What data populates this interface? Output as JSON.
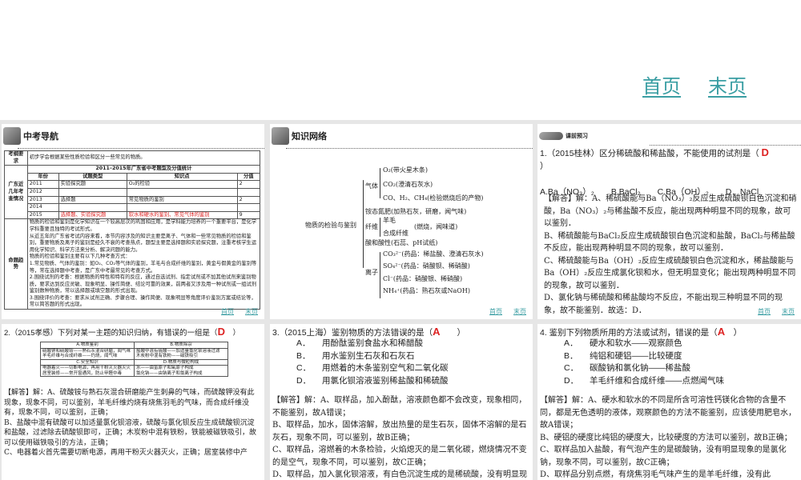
{
  "nav": {
    "home": "首页",
    "end": "末页"
  },
  "panel1": {
    "title": "中考导航",
    "req_label": "考纲要求",
    "req_text": "初步学会根据某些性质检验和区分一些常见的物质。",
    "stats_title": "2011–2015年广东省中考题型及分值统计",
    "recent_label": "广东近几年考查情况",
    "cols": [
      "年份",
      "试题类型",
      "知识点",
      "分值"
    ],
    "rows": [
      [
        "2011",
        "实验探究题",
        "O₂的检验",
        "2"
      ],
      [
        "2012",
        "",
        "",
        ""
      ],
      [
        "2013",
        "选择题",
        "常见物质的鉴别",
        "2"
      ],
      [
        "2014",
        "",
        "",
        ""
      ],
      [
        "2015",
        "选择题、实验探究题",
        "软水和硬水的鉴别、常见气体的鉴别",
        "9"
      ]
    ],
    "trend_label": "命题趋势",
    "trend_text": [
      "物质的检验和鉴别是化学知识在一个较高层次的巩固和应用，是学科能力培养的一个重要平台，是化学学科重要且独特的考试形式。",
      "从近五年的广东省考试内容来看，本节内容涉及的知识主要是离子、气体和一些常见物质的检验和鉴别，重要物质及离子的鉴别是经久不衰的考查热点，题型主要是选择题和实验探究题，注重考核学生运用化学知识、科学方法来分析、解决问题的能力。",
      "物质的检验和鉴别主要有以下几种考查方式：",
      "1.常见物质、气体的鉴别：如O₂、CO₂等气体的鉴别，羊毛与合成纤维的鉴别，黄金与假黄金的鉴别等等，常在选择题中考查，是广东中考最常见的考查方式。",
      "2.围绕试剂的考查：根据物质的特性和特有的反应，通过自选试剂、指定试剂或不加其他试剂来鉴别物质，要求达到反应灵敏、现象明显、操作简便、结论可靠的效果，前两者又涉及用一种试剂或一组试剂鉴别数种物质，常以选择题或填空题的形式出现。",
      "3.围绕评价的考查：要求从试剂正确、步骤合理、操作简便、现象明显等角度评价鉴别方案或结论等，常以简答题的形式出现。"
    ]
  },
  "panel2": {
    "title": "知识网络",
    "root": "物质的检验与鉴别",
    "gas": "气体",
    "gas_items": [
      "O₂(带火星木条)",
      "CO₂(澄清石灰水)",
      "CO、H₂、CH₄(检验燃烧后的产物)"
    ],
    "ammonium": "铵态氮肥(加熟石灰，研磨，闻气味)",
    "fiber": "纤维",
    "fiber_items": [
      "羊毛",
      "合成纤维"
    ],
    "fiber_method": "(燃烧，闻味道)",
    "acid": "酸和酸性(石蕊、pH试纸)",
    "ion": "离子",
    "ion_items": [
      "CO₃²⁻(药品：稀盐酸、澄清石灰水)",
      "SO₄²⁻(药品：硝酸钡、稀硝酸)",
      "Cl⁻(药品：硝酸银、稀硝酸)",
      "NH₄⁺(药品：熟石灰或NaOH)"
    ]
  },
  "panel3": {
    "title": "课前预习",
    "question": "1.（2015桂林）区分稀硫酸和稀盐酸，不能使用的试剂是（",
    "answer": "D",
    "close": "）",
    "options": "A.Ba（NO₃）₂　　B.BaCl₂　　C.Ba（OH）₂　　D．NaCl",
    "solution": [
      "【解答】解：A、稀硫酸能与Ba（NO₃）₂反应生成硫酸钡白色沉淀和硝酸，Ba（NO₃）₂与稀盐酸不反应，能出现两种明显不同的现象，故可以鉴别．",
      "B、稀硫酸能与BaCl₂反应生成硫酸钡白色沉淀和盐酸，BaCl₂与稀盐酸不反应，能出现两种明显不同的现象，故可以鉴别．",
      "C、稀硫酸能与Ba（OH）₂反应生成硫酸钡白色沉淀和水，稀盐酸能与Ba（OH）₂反应生成氯化钡和水，但无明显变化；能出现两种明显不同的现象，故可以鉴别．",
      "D、氯化钠与稀硫酸和稀盐酸均不反应，不能出现三种明显不同的现象，故不能鉴别．故选：D．"
    ]
  },
  "panel4": {
    "question": "2.（2015孝感）下列对某一主题的知识归纳，有错误的一组是（",
    "answer": "D",
    "close": "）",
    "table": [
      {
        "head": "A.物质鉴别",
        "body": [
          "硫酸钾和硫酸铵——熟石灰混合研磨，闻气味",
          "羊毛纤维与合成纤维——灼烧，闻气味"
        ]
      },
      {
        "head": "B.物质除杂",
        "body": [
          "盐酸中混有硫酸——加适量氯化钡溶液过滤",
          "木炭粉中混有铁粉——磁铁吸引"
        ]
      },
      {
        "head": "C.安全知识",
        "body": [
          "电器着火——切断电源，再用干粉灭火器灭火",
          "居室装修——常开窗通风，防止甲醛中毒"
        ]
      },
      {
        "head": "D.物质与微粒构成",
        "body": [
          "水——由氢原子和氧原子构成",
          "氯化钠——由钠离子和氯离子构成"
        ]
      }
    ],
    "solution": [
      "【解答】解：A、硫酸铵与熟石灰混合研磨能产生刺鼻的气味，而硫酸钾没有此现象，现象不同，可以鉴别，羊毛纤维灼烧有烧焦羽毛的气味，而合成纤维没有，现象不同，可以鉴别，正确；",
      "B、盐酸中混有硫酸可以加适量氯化钡溶液，硫酸与氯化钡反应生成硫酸钡沉淀和盐酸，过滤除去硫酸钡即可，正确；木炭粉中混有铁粉，铁能被磁铁吸引，故可以使用磁铁吸引的方法，正确；",
      "C、电器着火首先需要切断电源，再用干粉灭火器灭火，正确；居室装修中产"
    ]
  },
  "panel5": {
    "question": "3.（2015上海）鉴别物质的方法错误的是（",
    "answer": "A",
    "close": "）",
    "options": [
      [
        "A．",
        "用酚酞鉴别食盐水和稀醋酸"
      ],
      [
        "B．",
        "用水鉴别生石灰和石灰石"
      ],
      [
        "C．",
        "用燃着的木条鉴别空气和二氧化碳"
      ],
      [
        "D．",
        "用氯化钡溶液鉴别稀盐酸和稀硫酸"
      ]
    ],
    "solution": [
      "【解答】解：A、取样品，加入酚酞，溶液颜色都不会改变，现象相同，不能鉴别，故A错误；",
      "B、取样品，加水，固体溶解，放出热量的是生石灰，固体不溶解的是石灰石，现象不同，可以鉴别，故B正确；",
      "C、取样品，溶燃着的木条检验，火焰熄灭的是二氧化碳，燃烧情况不变的是空气，现象不同，可以鉴别，故C正确；",
      "D、取样品，加入氯化钡溶液，有白色沉淀生成的是稀硫酸，没有明显现象的是稀盐酸，现象不同，可以鉴别，故D正确．"
    ]
  },
  "panel6": {
    "question": "4. 鉴别下列物质所用的方法或试剂，错误的是（",
    "answer": "A",
    "close": "）",
    "options": [
      [
        "A．",
        "硬水和软水——观察颜色"
      ],
      [
        "B．",
        "纯铝和硬铝——比较硬度"
      ],
      [
        "C．",
        "碳酸钠和氯化钠——稀盐酸"
      ],
      [
        "D．",
        "羊毛纤维和合成纤维——点燃闻气味"
      ]
    ],
    "solution": [
      "【解答】解：A、硬水和软水的不同是所含可溶性钙镁化合物的含量不同，都是无色透明的液体，观察颜色的方法不能鉴别，应该使用肥皂水，故A错误；",
      "B、硬铝的硬度比纯铝的硬度大，比较硬度的方法可以鉴别，故B正确；",
      "C、取样品加入盐酸，有气泡产生的是碳酸钠，没有明显现象的是氯化钠，现象不同，可以鉴别，故C正确；",
      "D、取样品分别点燃，有烧焦羽毛气味产生的是羊毛纤维，没有此"
    ]
  }
}
